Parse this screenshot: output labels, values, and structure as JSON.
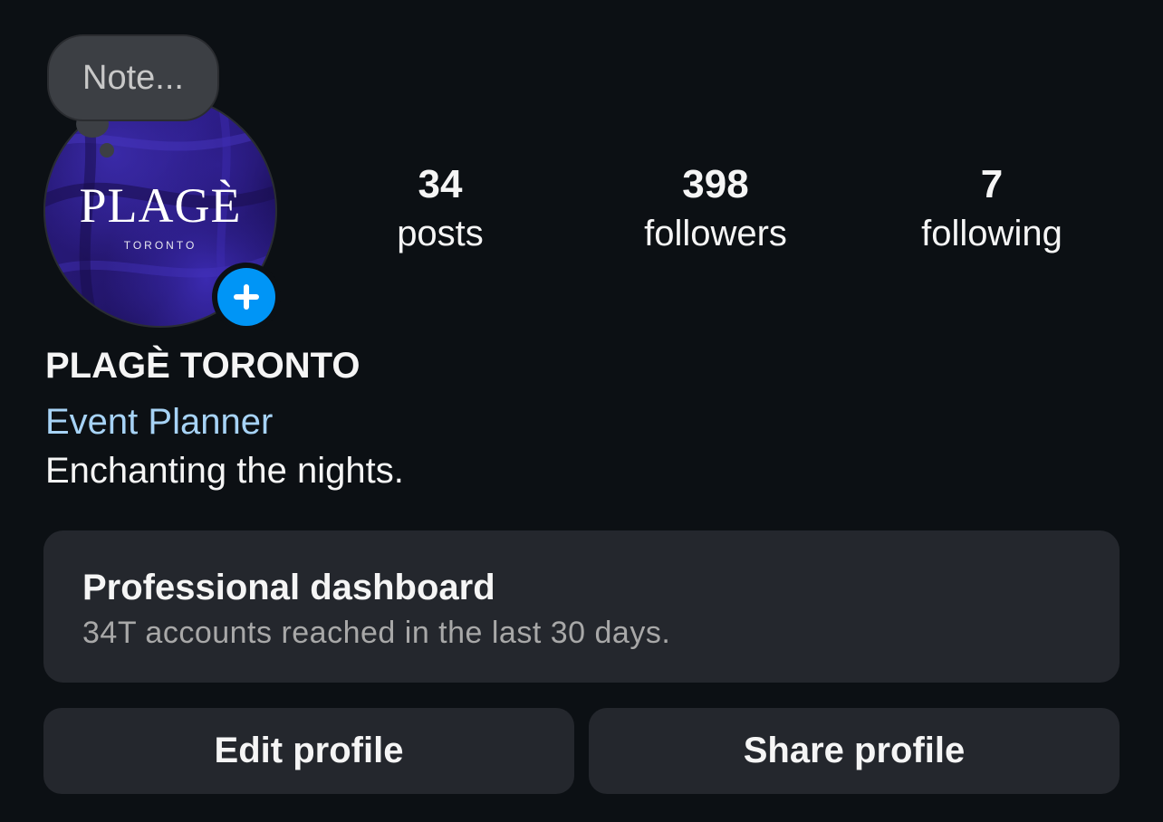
{
  "note": {
    "placeholder": "Note..."
  },
  "avatar": {
    "logo_text": "PLAGÈ",
    "logo_subtext": "TORONTO",
    "add_story_icon": "plus-icon",
    "colors": {
      "fabric": "#2b1c85",
      "badge": "#0095f6"
    }
  },
  "stats": [
    {
      "value": "34",
      "label": "posts"
    },
    {
      "value": "398",
      "label": "followers"
    },
    {
      "value": "7",
      "label": "following"
    }
  ],
  "profile": {
    "name": "PLAGÈ TORONTO",
    "category": "Event Planner",
    "bio": "Enchanting the nights."
  },
  "dashboard": {
    "title": "Professional dashboard",
    "subtitle": "34T accounts reached in the last 30 days."
  },
  "actions": {
    "edit_label": "Edit profile",
    "share_label": "Share profile"
  },
  "theme": {
    "background": "#0c1014",
    "card": "#24272d",
    "link": "#a7d3f6"
  }
}
